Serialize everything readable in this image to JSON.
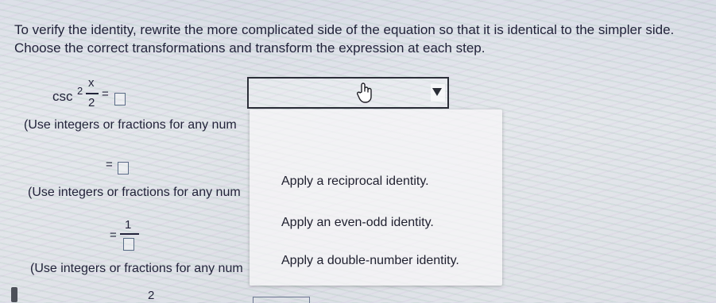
{
  "instructions": {
    "line1": "To verify the identity, rewrite the more complicated side of the equation so that it is identical to the simpler side.",
    "line2": "Choose the correct transformations and transform the expression at each step."
  },
  "equation": {
    "func": "csc",
    "exponent": "2",
    "numerator": "x",
    "denominator": "2",
    "equals": "="
  },
  "hints": {
    "step1": "(Use integers or fractions for any num",
    "step2": "(Use integers or fractions for any num",
    "step3": "(Use integers or fractions for any num"
  },
  "steps": {
    "step2_equals": "=",
    "step3_equals": "=",
    "step3_numerator": "1"
  },
  "dropdown": {
    "selected": "",
    "options": [
      "Apply a reciprocal identity.",
      "Apply an even-odd identity.",
      "Apply a double-number identity."
    ]
  },
  "footer": {
    "fraction_denominator": "2"
  }
}
